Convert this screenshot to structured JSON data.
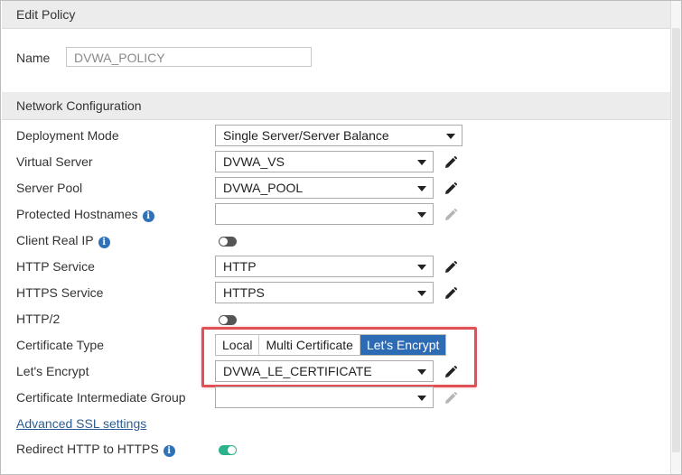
{
  "header": {
    "title": "Edit Policy"
  },
  "name_field": {
    "label": "Name",
    "value": "DVWA_POLICY"
  },
  "network": {
    "title": "Network Configuration",
    "deployment_mode": {
      "label": "Deployment Mode",
      "value": "Single Server/Server Balance"
    },
    "virtual_server": {
      "label": "Virtual Server",
      "value": "DVWA_VS"
    },
    "server_pool": {
      "label": "Server Pool",
      "value": "DVWA_POOL"
    },
    "protected_hostnames": {
      "label": "Protected Hostnames",
      "value": ""
    },
    "client_real_ip": {
      "label": "Client Real IP",
      "enabled": false
    },
    "http_service": {
      "label": "HTTP Service",
      "value": "HTTP"
    },
    "https_service": {
      "label": "HTTPS Service",
      "value": "HTTPS"
    },
    "http2": {
      "label": "HTTP/2",
      "enabled": false
    },
    "certificate_type": {
      "label": "Certificate Type",
      "options": [
        "Local",
        "Multi Certificate",
        "Let's Encrypt"
      ],
      "selected": "Let's Encrypt"
    },
    "lets_encrypt": {
      "label": "Let's Encrypt",
      "value": "DVWA_LE_CERTIFICATE"
    },
    "cert_intermediate_group": {
      "label": "Certificate Intermediate Group",
      "value": ""
    },
    "advanced_ssl_link": "Advanced SSL settings",
    "redirect_http_to_https": {
      "label": "Redirect HTTP to HTTPS",
      "enabled": true
    }
  },
  "colors": {
    "accent": "#2d6bb5",
    "toggle_on": "#2ab38a",
    "highlight": "#e05055",
    "info_icon": "#2f72b8"
  },
  "icons": {
    "info": "info-circle-icon",
    "edit": "pencil-icon",
    "dropdown": "chevron-down-icon"
  }
}
